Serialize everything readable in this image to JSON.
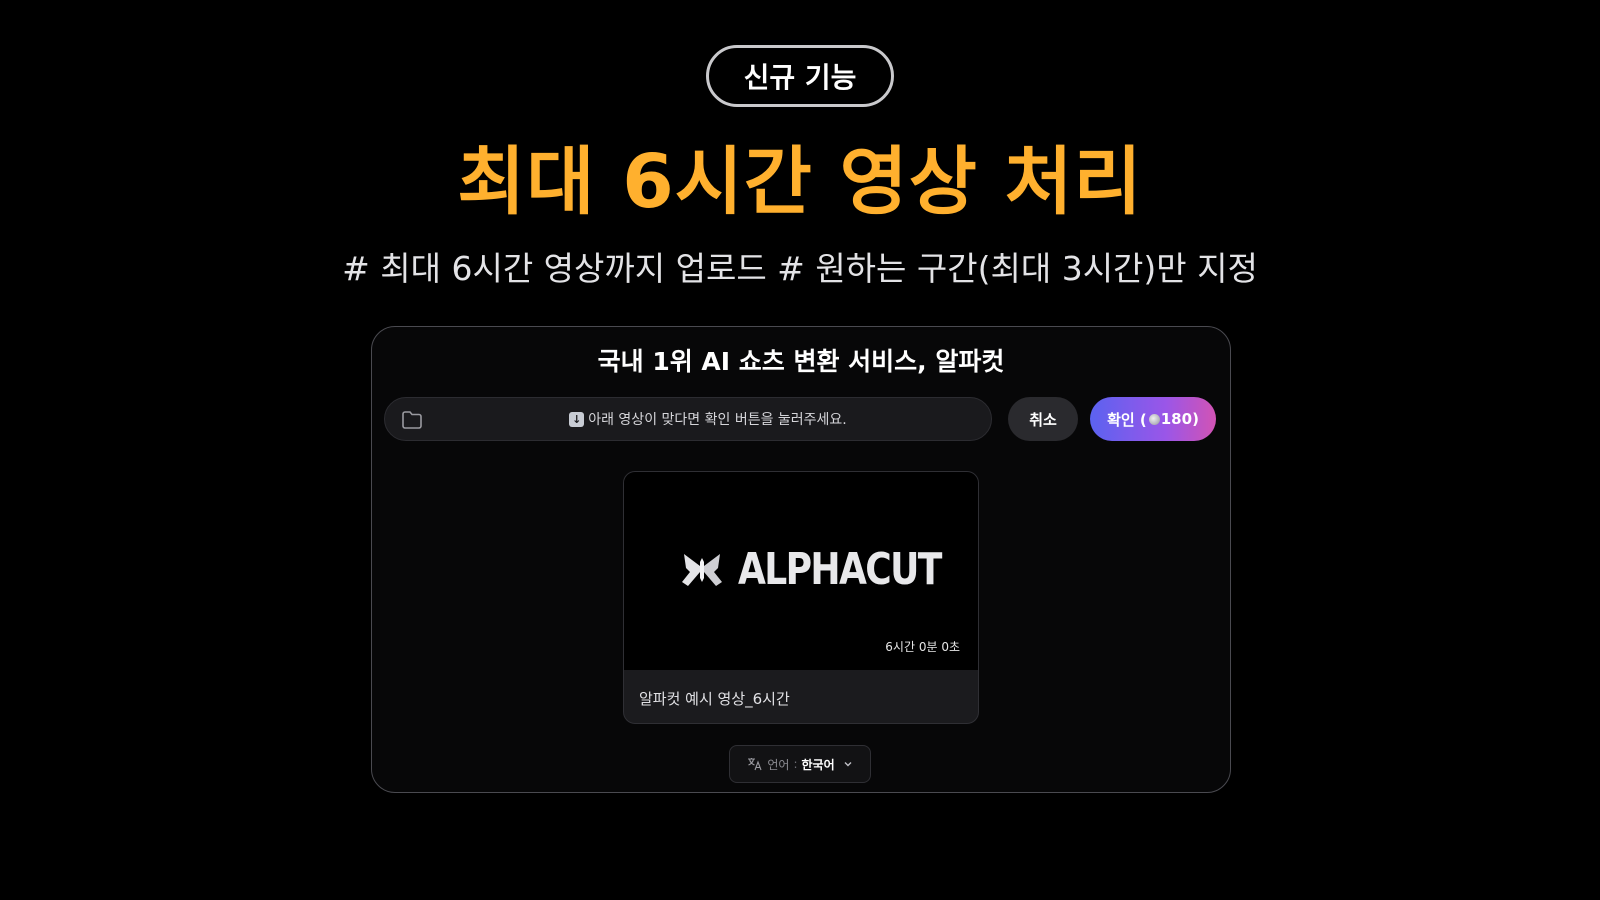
{
  "badge": {
    "label": "신규 기능"
  },
  "headline": "최대 6시간 영상 처리",
  "subheadline": "# 최대 6시간 영상까지 업로드 # 원하는 구간(최대 3시간)만 지정",
  "panel": {
    "title": "국내 1위 AI 쇼츠 변환 서비스, 알파컷",
    "bar_message": "아래 영상이 맞다면 확인 버튼을 눌러주세요.",
    "cancel_label": "취소",
    "confirm": {
      "prefix": "확인 (",
      "credits": "180",
      "suffix": ")"
    },
    "video": {
      "logo_text": "ALPHACUT",
      "duration": "6시간 0분 0초",
      "title": "알파컷 예시 영상_6시간"
    },
    "language": {
      "label": "언어",
      "separator": ":",
      "value": "한국어"
    }
  },
  "colors": {
    "background": "#000000",
    "headline": "#ffb02e",
    "confirm_gradient_start": "#5b62f0",
    "confirm_gradient_end": "#d253b4"
  },
  "icons": [
    "folder-icon",
    "download-arrow-icon",
    "coin-icon",
    "alphacut-logo-icon",
    "translate-icon",
    "chevron-down-icon"
  ]
}
